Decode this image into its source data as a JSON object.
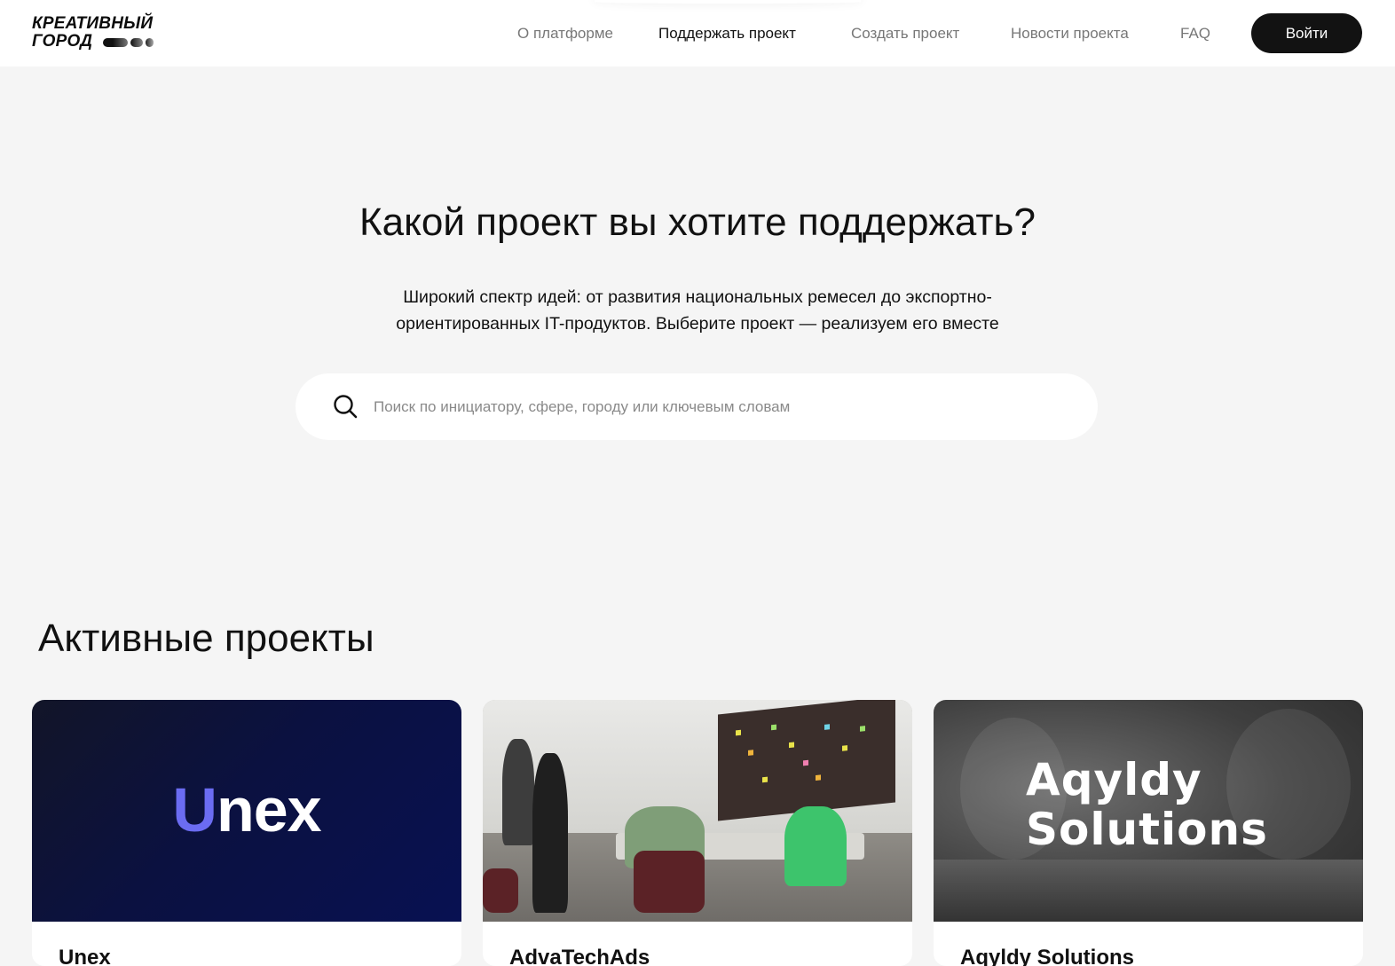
{
  "header": {
    "logo_line1": "КРЕАТИВНЫЙ",
    "logo_line2": "ГОРОД",
    "nav": [
      {
        "label": "О платформе",
        "active": false
      },
      {
        "label": "Поддержать проект",
        "active": true
      },
      {
        "label": "Создать проект",
        "active": false
      },
      {
        "label": "Новости проекта",
        "active": false
      },
      {
        "label": "FAQ",
        "active": false
      }
    ],
    "login_label": "Войти"
  },
  "hero": {
    "title": "Какой проект вы хотите поддержать?",
    "subtitle_line1": "Широкий спектр идей: от развития национальных ремесел до экспортно-",
    "subtitle_line2": "ориентированных IT-продуктов. Выберите проект — реализуем его вместе",
    "search": {
      "value": "",
      "placeholder": "Поиск по инициатору, сфере, городу или ключевым словам",
      "icon": "search-icon"
    }
  },
  "projects": {
    "title": "Активные проекты",
    "cards": [
      {
        "name": "Unex",
        "logo_first": "U",
        "logo_rest": "nex"
      },
      {
        "name": "AdvaTechAds"
      },
      {
        "name": "Aqyldy Solutions",
        "logo_line1": "Aqyldy",
        "logo_line2": "Solutions"
      }
    ]
  },
  "colors": {
    "accent_dark": "#121212",
    "unex_blue": "#6b6cf2",
    "background": "#f5f5f5"
  }
}
